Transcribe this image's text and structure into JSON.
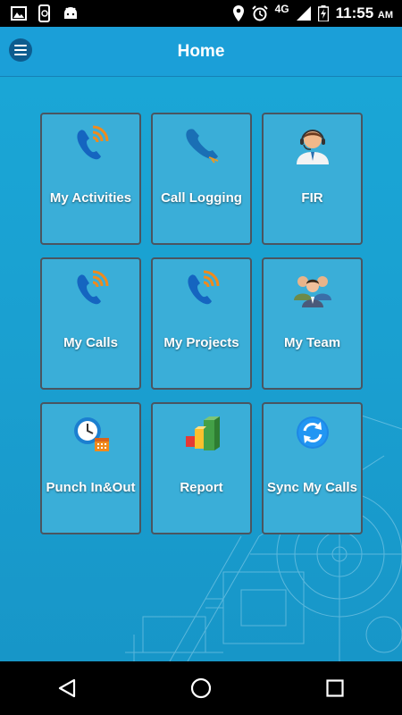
{
  "status_bar": {
    "network": "4G",
    "time": "11:55",
    "ampm": "AM"
  },
  "header": {
    "title": "Home"
  },
  "tiles": [
    {
      "label": "My Activities",
      "icon": "phone-signal-icon"
    },
    {
      "label": "Call Logging",
      "icon": "phone-handset-icon"
    },
    {
      "label": "FIR",
      "icon": "support-agent-icon"
    },
    {
      "label": "My Calls",
      "icon": "phone-signal-icon"
    },
    {
      "label": "My Projects",
      "icon": "phone-signal-icon"
    },
    {
      "label": "My Team",
      "icon": "team-icon"
    },
    {
      "label": "Punch In&Out",
      "icon": "clock-calendar-icon"
    },
    {
      "label": "Report",
      "icon": "bar-chart-icon"
    },
    {
      "label": "Sync My Calls",
      "icon": "sync-icon"
    }
  ],
  "colors": {
    "appbar": "#1b9fd8",
    "background": "#1aa6d6",
    "tile": "#3aaed8",
    "tile_border": "#4a5560"
  }
}
